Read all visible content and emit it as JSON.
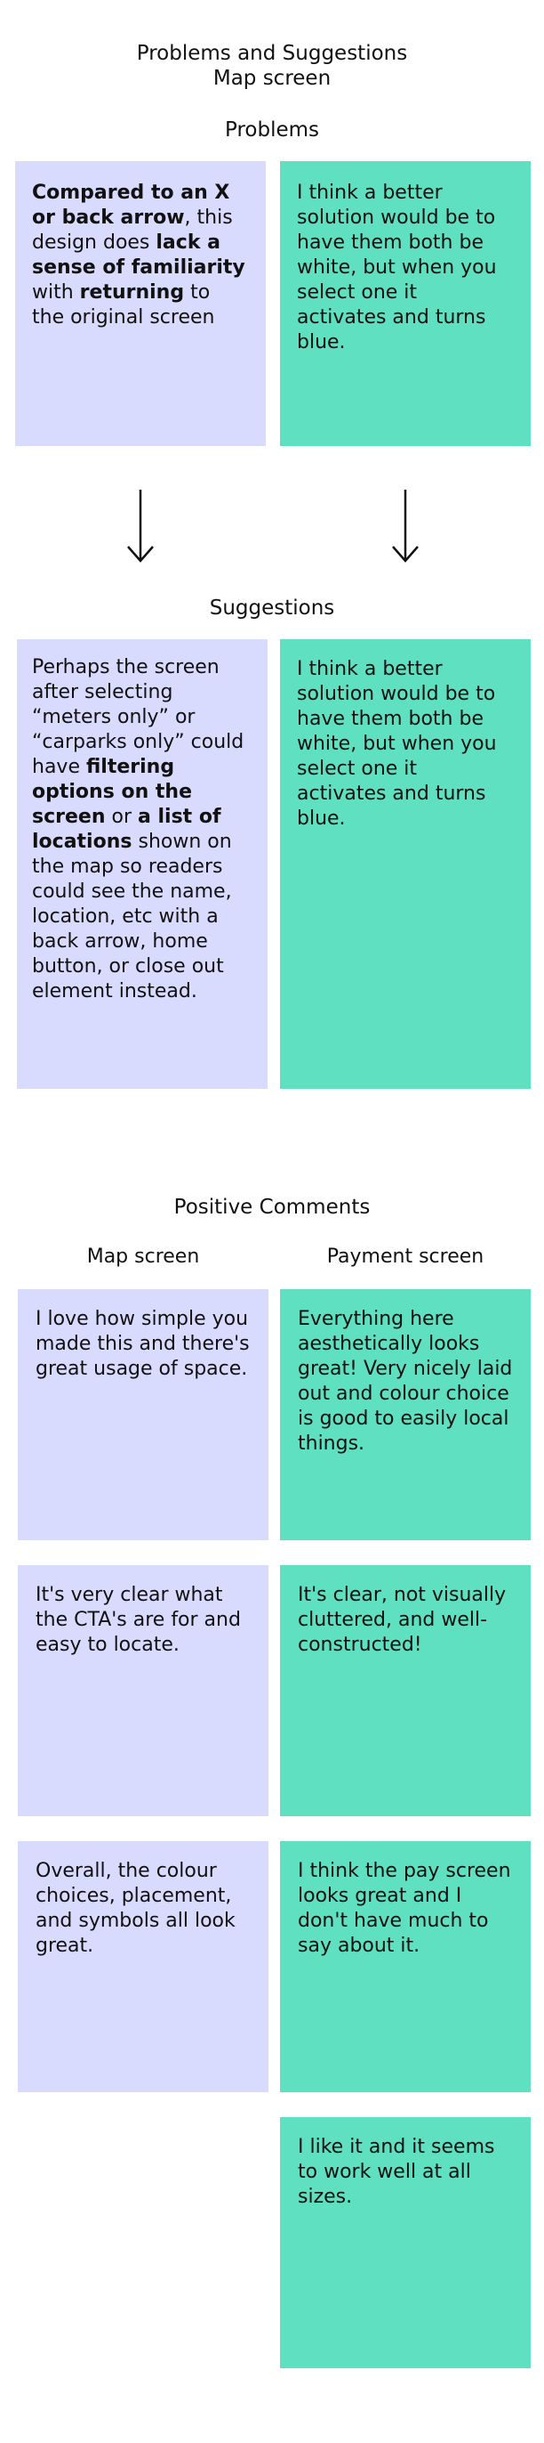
{
  "header": {
    "title_line1": "Problems and Suggestions",
    "title_line2": "Map screen"
  },
  "problems": {
    "heading": "Problems",
    "left": {
      "p1": "Compared to an X or back arrow",
      "p2": ", this design does ",
      "p3": "lack a sense of familiarity",
      "p4": " with ",
      "p5": "returning",
      "p6": " to the original screen"
    },
    "right": "I think a better solution would be to have them both be white, but when you select one it activates and turns blue."
  },
  "arrows": {
    "left_icon": "arrow-down-icon",
    "right_icon": "arrow-down-icon"
  },
  "suggestions": {
    "heading": "Suggestions",
    "left": {
      "p1": "Perhaps the screen after selecting “meters only” or “carparks only” could have ",
      "p2": "filtering options on the screen",
      "p3": " or ",
      "p4": "a list of locations",
      "p5": " shown on the map so readers could see the name, location, etc with a back arrow, home button, or close out element instead."
    },
    "right": "I think a better solution would be to have them both be white, but when you select one it activates and turns blue."
  },
  "positive": {
    "heading": "Positive Comments",
    "map_heading": "Map screen",
    "payment_heading": "Payment screen",
    "map_comments": [
      "I love how simple you made this and there's great usage of space.",
      "It's very clear what the CTA's are for and easy to locate.",
      "Overall, the colour choices, placement, and symbols all look great."
    ],
    "payment_comments": [
      "Everything here aesthetically looks great! Very nicely laid out and colour choice is good to easily local things.",
      "It's clear, not visually cluttered, and well-constructed!",
      "I think the pay screen looks great and I don't have much to say about it.",
      "I like it and it seems to work well at all sizes."
    ]
  },
  "colors": {
    "purple_card": "#d9dbfe",
    "green_card": "#5fe0c0",
    "text": "#111111"
  }
}
